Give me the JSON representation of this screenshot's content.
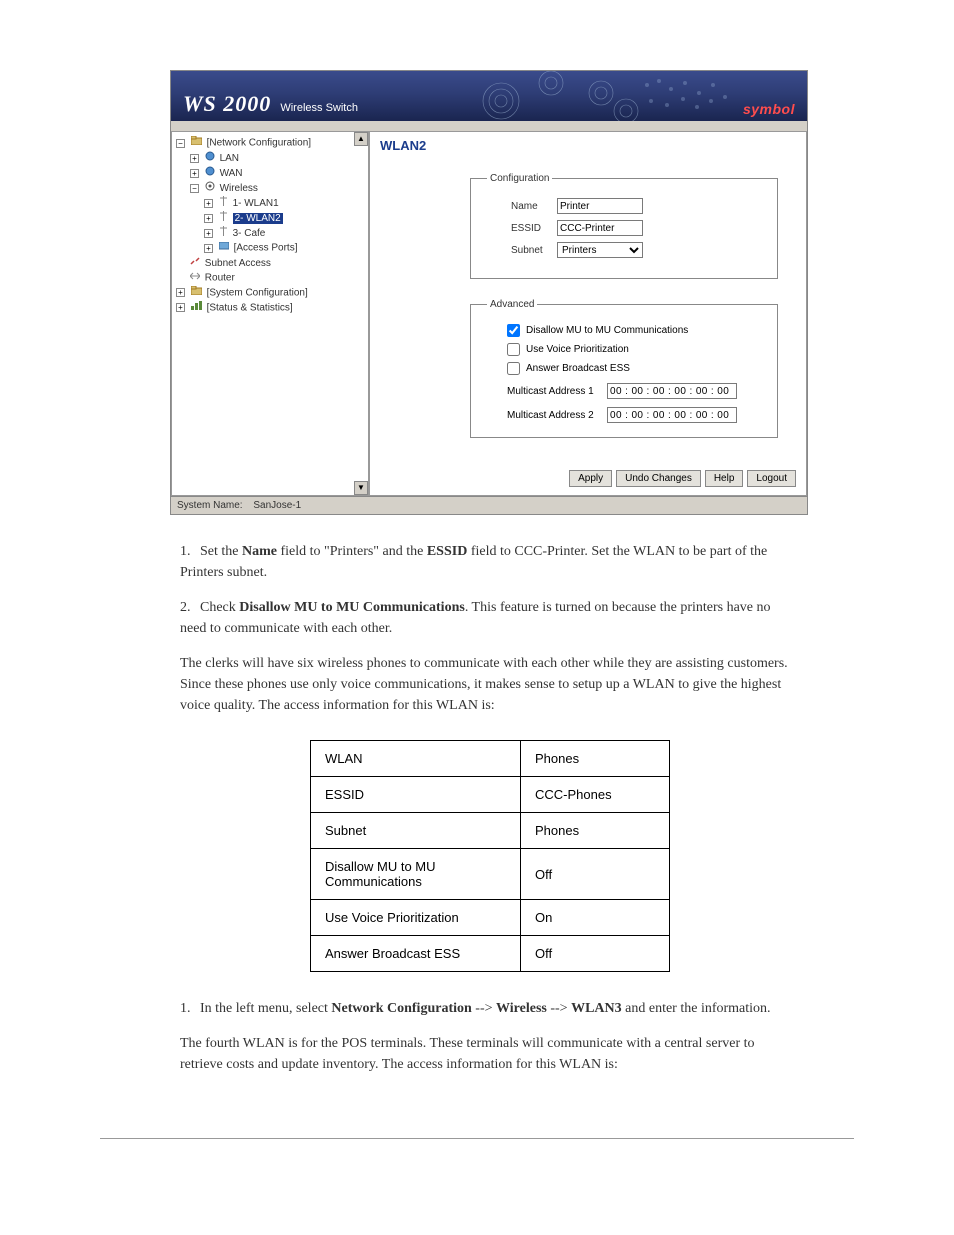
{
  "banner": {
    "title_main": "WS 2000",
    "title_sub": "Wireless Switch",
    "brand": "symbol"
  },
  "tree": {
    "net_cfg": "[Network Configuration]",
    "lan": "LAN",
    "wan": "WAN",
    "wireless": "Wireless",
    "wlan1": "1- WLAN1",
    "wlan2": "2- WLAN2",
    "cafe": "3- Cafe",
    "ap": "[Access Ports]",
    "subnet_access": "Subnet Access",
    "router": "Router",
    "sys_cfg": "[System Configuration]",
    "stats": "[Status & Statistics]"
  },
  "page": {
    "heading": "WLAN2",
    "cfg_legend": "Configuration",
    "adv_legend": "Advanced",
    "name_lbl": "Name",
    "essid_lbl": "ESSID",
    "subnet_lbl": "Subnet",
    "name_val": "Printer",
    "essid_val": "CCC-Printer",
    "subnet_val": "Printers",
    "disallow": "Disallow MU to MU Communications",
    "voice": "Use Voice Prioritization",
    "ess": "Answer Broadcast ESS",
    "mc1_lbl": "Multicast Address 1",
    "mc2_lbl": "Multicast Address 2",
    "mc1_val": "00 : 00 : 00 : 00 : 00 : 00",
    "mc2_val": "00 : 00 : 00 : 00 : 00 : 00"
  },
  "buttons": {
    "apply": "Apply",
    "undo": "Undo Changes",
    "help": "Help",
    "logout": "Logout"
  },
  "status": {
    "label": "System Name:",
    "value": "SanJose-1"
  },
  "doc": {
    "p1a": "Set the ",
    "p1b": "Name",
    "p1c": " field to \"Printers\" and the ",
    "p1d": "ESSID",
    "p1e": " field to CCC-Printer. Set the WLAN to be part of the Printers subnet.",
    "p2a": "Check ",
    "p2b": "Disallow MU to MU Communications",
    "p2c": ". This feature is turned on because the printers have no need to communicate with each other.",
    "p3a": "The clerks will have six wireless phones to communicate with each other while they are assisting customers. Since these phones use only voice communications, it makes sense to setup up a WLAN to give the highest voice quality. The access information for this WLAN is:",
    "th1": "WLAN",
    "td1": "Phones",
    "th2": "ESSID",
    "td2": "CCC-Phones",
    "th3": "Subnet",
    "td3": "Phones",
    "th4": "Disallow MU to MU Communications",
    "td4": "Off",
    "th5": "Use Voice Prioritization",
    "td5": "On",
    "th6": "Answer Broadcast ESS",
    "td6": "Off",
    "b1a": "In the left menu, select ",
    "b1b": "Network Configuration",
    "b1c": "Wireless",
    "b1d": "WLAN3",
    "b1e": " and enter the information.",
    "b2a": "The fourth WLAN is for the POS terminals. These terminals will communicate with a central server to retrieve costs and update inventory. The access information for this WLAN is:"
  }
}
